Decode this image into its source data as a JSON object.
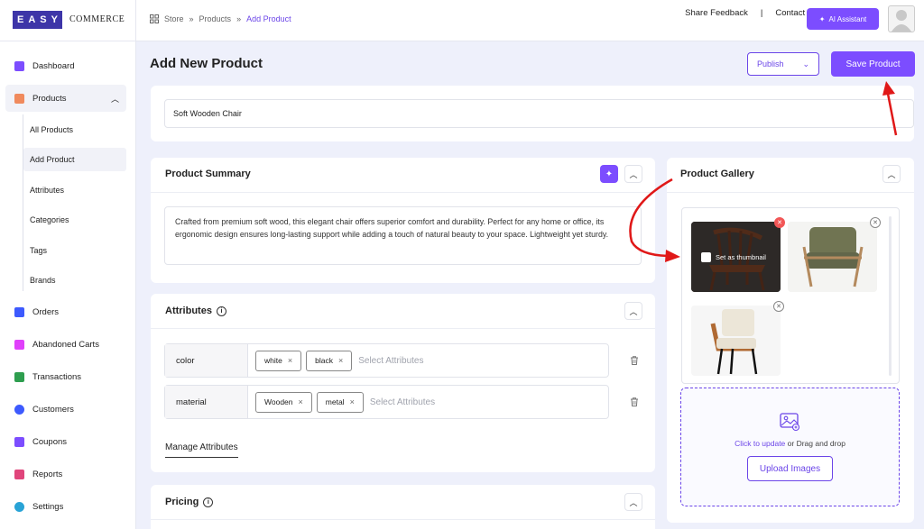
{
  "brand": {
    "box": "EASY",
    "text": "COMMERCE"
  },
  "breadcrumb": [
    "Store",
    "Products",
    "Add Product"
  ],
  "header": {
    "feedback": "Share Feedback",
    "separator": "|",
    "support": "Contact Support",
    "ai_button": "AI Assistant"
  },
  "sidebar": {
    "items": [
      {
        "label": "Dashboard",
        "icon": "dashboard-icon",
        "color": "#7c4dff"
      },
      {
        "label": "Products",
        "icon": "box-icon",
        "color": "#f08a5d"
      },
      {
        "label": "Orders",
        "icon": "truck-icon",
        "color": "#3d5afe"
      },
      {
        "label": "Abandoned Carts",
        "icon": "cart-icon",
        "color": "#e040fb"
      },
      {
        "label": "Transactions",
        "icon": "money-icon",
        "color": "#2e9e4f"
      },
      {
        "label": "Customers",
        "icon": "users-icon",
        "color": "#3d5afe"
      },
      {
        "label": "Coupons",
        "icon": "coupon-icon",
        "color": "#7c4dff"
      },
      {
        "label": "Reports",
        "icon": "report-icon",
        "color": "#e0457b"
      },
      {
        "label": "Settings",
        "icon": "gear-icon",
        "color": "#29a3d6"
      }
    ],
    "sub_items": [
      "All Products",
      "Add Product",
      "Attributes",
      "Categories",
      "Tags",
      "Brands"
    ]
  },
  "page": {
    "title": "Add New Product",
    "publish": "Publish",
    "save": "Save Product"
  },
  "product_name": "Soft Wooden Chair",
  "summary": {
    "title": "Product Summary",
    "text": "Crafted from premium soft wood, this elegant chair offers superior comfort and durability. Perfect for any home or office, its ergonomic design ensures long-lasting support while adding a touch of natural beauty to your space. Lightweight yet sturdy."
  },
  "attributes": {
    "title": "Attributes",
    "info": "i",
    "placeholder": "Select Attributes",
    "rows": [
      {
        "name": "color",
        "values": [
          "white",
          "black"
        ]
      },
      {
        "name": "material",
        "values": [
          "Wooden",
          "metal"
        ]
      }
    ],
    "manage": "Manage Attributes"
  },
  "pricing": {
    "title": "Pricing",
    "info": "i"
  },
  "gallery": {
    "title": "Product Gallery",
    "set_thumbnail": "Set as thumbnail",
    "click": "Click to update",
    "or": " or Drag and drop",
    "upload": "Upload Images"
  }
}
